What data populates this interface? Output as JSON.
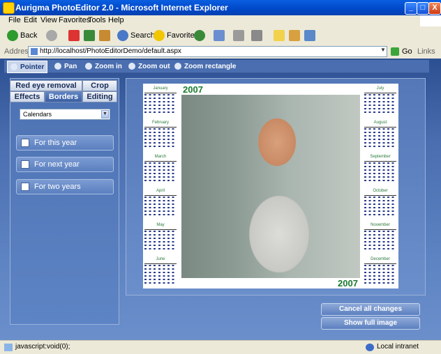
{
  "window": {
    "title": "Aurigma PhotoEditor 2.0 - Microsoft Internet Explorer",
    "min": "_",
    "max": "□",
    "close": "X"
  },
  "menu": [
    "File",
    "Edit",
    "View",
    "Favorites",
    "Tools",
    "Help"
  ],
  "toolbar": {
    "back": "Back",
    "search": "Search",
    "favorites": "Favorites"
  },
  "address": {
    "label": "Address",
    "url": "http://localhost/PhotoEditorDemo/default.aspx",
    "go": "Go",
    "links": "Links"
  },
  "editor_tools": [
    {
      "label": "Pointer",
      "icon": "pointer-icon",
      "active": true
    },
    {
      "label": "Pan",
      "icon": "hand-icon",
      "active": false
    },
    {
      "label": "Zoom in",
      "icon": "zoom-in-icon",
      "active": false
    },
    {
      "label": "Zoom out",
      "icon": "zoom-out-icon",
      "active": false
    },
    {
      "label": "Zoom rectangle",
      "icon": "zoom-rectangle-icon",
      "active": false
    }
  ],
  "tabs": {
    "red_eye": "Red eye removal",
    "crop": "Crop",
    "effects": "Effects",
    "borders": "Borders",
    "editing": "Editing"
  },
  "frame_select": {
    "value": "Calendars"
  },
  "options": [
    {
      "label": "For this year",
      "checked": false
    },
    {
      "label": "For next year",
      "checked": false
    },
    {
      "label": "For two years",
      "checked": false
    }
  ],
  "calendar": {
    "year_top": "2007",
    "year_bottom": "2007",
    "months_left": [
      "January",
      "February",
      "March",
      "April",
      "May",
      "June"
    ],
    "months_right": [
      "July",
      "August",
      "September",
      "October",
      "November",
      "December"
    ]
  },
  "actions": {
    "cancel": "Cancel all changes",
    "show_full": "Show full image"
  },
  "status": {
    "text": "javascript:void(0);",
    "zone": "Local intranet"
  },
  "colors": {
    "accent": "#2c4f92",
    "panel": "#5d83c2",
    "title_bar": "#0047c8",
    "calendar_green": "#1a7a2e"
  }
}
